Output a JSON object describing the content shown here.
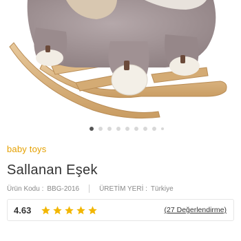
{
  "product": {
    "image_alt": "Sallanan Eşek sallanan oyuncak",
    "carousel": {
      "total": 9,
      "active_index": 0
    },
    "brand": "baby toys",
    "name": "Sallanan Eşek",
    "code_label": "Ürün Kodu :",
    "code_value": "BBG-2016",
    "origin_label": "ÜRETİM YERİ :",
    "origin_value": "Türkiye"
  },
  "rating": {
    "score": "4.63",
    "stars": 5,
    "reviews_link": "(27 Değerlendirme)"
  },
  "colors": {
    "brand": "#e5a000",
    "star": "#f2b600",
    "plush": "#9e8f91",
    "wood": "#d9b483"
  }
}
